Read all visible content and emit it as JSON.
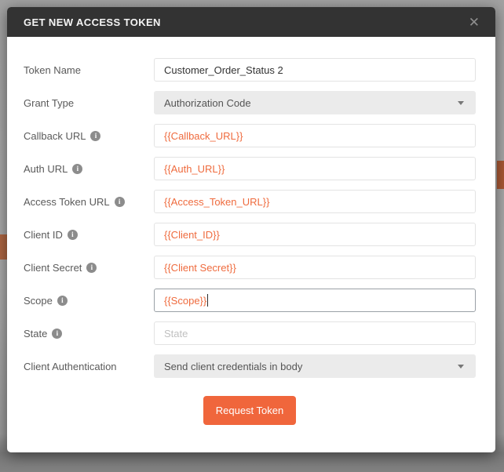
{
  "dialog": {
    "title": "GET NEW ACCESS TOKEN"
  },
  "icons": {
    "close": "✕",
    "info": "i"
  },
  "fields": [
    {
      "label": "Token Name",
      "value": "Customer_Order_Status 2",
      "control": "text",
      "info": false,
      "variable": false
    },
    {
      "label": "Grant Type",
      "value": "Authorization Code",
      "control": "select",
      "info": false,
      "variable": false
    },
    {
      "label": "Callback URL",
      "value": "{{Callback_URL}}",
      "control": "text",
      "info": true,
      "variable": true
    },
    {
      "label": "Auth URL",
      "value": "{{Auth_URL}}",
      "control": "text",
      "info": true,
      "variable": true
    },
    {
      "label": "Access Token URL",
      "value": "{{Access_Token_URL}}",
      "control": "text",
      "info": true,
      "variable": true
    },
    {
      "label": "Client ID",
      "value": "{{Client_ID}}",
      "control": "text",
      "info": true,
      "variable": true
    },
    {
      "label": "Client Secret",
      "value": "{{Client Secret}}",
      "control": "text",
      "info": true,
      "variable": true
    },
    {
      "label": "Scope",
      "value": "{{Scope}}",
      "control": "text",
      "info": true,
      "variable": true,
      "focused": true
    },
    {
      "label": "State",
      "value": "",
      "control": "text",
      "info": true,
      "variable": false,
      "placeholder": "State"
    },
    {
      "label": "Client Authentication",
      "value": "Send client credentials in body",
      "control": "select",
      "info": false,
      "variable": false
    }
  ],
  "actions": {
    "request_token": "Request Token"
  },
  "colors": {
    "accent_orange": "#ef6b3e",
    "button_orange": "#f0663c",
    "header_bg": "#333333"
  }
}
